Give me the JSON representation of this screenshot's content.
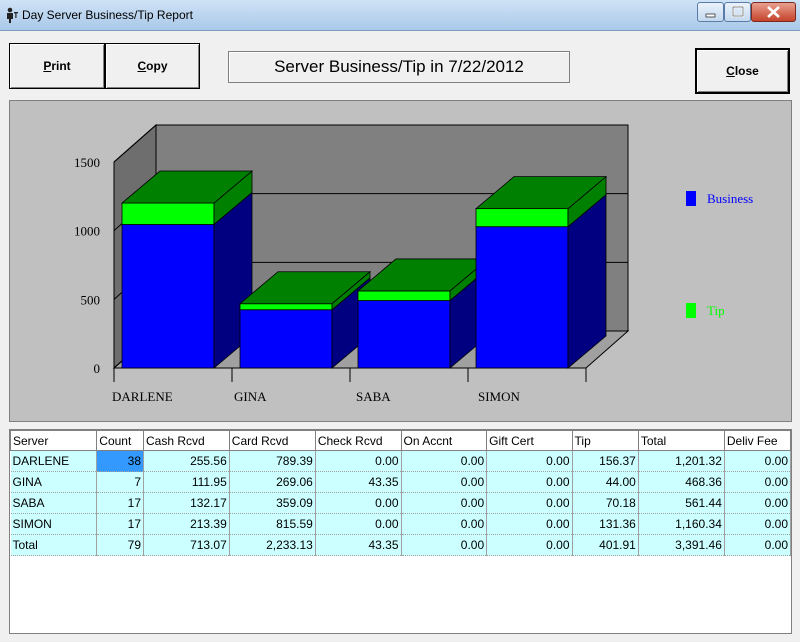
{
  "window": {
    "title": "Day Server Business/Tip Report"
  },
  "toolbar": {
    "print_label": "Print",
    "copy_label": "Copy",
    "close_label": "Close"
  },
  "report_title": "Server Business/Tip in 7/22/2012",
  "chart_data": {
    "type": "bar",
    "stacked": true,
    "three_d": true,
    "categories": [
      "DARLENE",
      "GINA",
      "SABA",
      "SIMON"
    ],
    "series": [
      {
        "name": "Business",
        "values": [
          1045.0,
          424.0,
          491.0,
          1029.0
        ],
        "color": "#0000ff"
      },
      {
        "name": "Tip",
        "values": [
          156.37,
          44.0,
          70.18,
          131.36
        ],
        "color": "#00ff00"
      }
    ],
    "yticks": [
      "0",
      "500",
      "1000",
      "1500"
    ],
    "ylim": [
      0,
      1500
    ],
    "legend": "right",
    "grid": true
  },
  "table": {
    "headers": [
      "Server",
      "Count",
      "Cash Rcvd",
      "Card Rcvd",
      "Check Rcvd",
      "On Accnt",
      "Gift Cert",
      "Tip",
      "Total",
      "Deliv Fee"
    ],
    "rows": [
      [
        "DARLENE",
        "38",
        "255.56",
        "789.39",
        "0.00",
        "0.00",
        "0.00",
        "156.37",
        "1,201.32",
        "0.00"
      ],
      [
        "GINA",
        "7",
        "111.95",
        "269.06",
        "43.35",
        "0.00",
        "0.00",
        "44.00",
        "468.36",
        "0.00"
      ],
      [
        "SABA",
        "17",
        "132.17",
        "359.09",
        "0.00",
        "0.00",
        "0.00",
        "70.18",
        "561.44",
        "0.00"
      ],
      [
        "SIMON",
        "17",
        "213.39",
        "815.59",
        "0.00",
        "0.00",
        "0.00",
        "131.36",
        "1,160.34",
        "0.00"
      ],
      [
        "Total",
        "79",
        "713.07",
        "2,233.13",
        "43.35",
        "0.00",
        "0.00",
        "401.91",
        "3,391.46",
        "0.00"
      ]
    ]
  }
}
